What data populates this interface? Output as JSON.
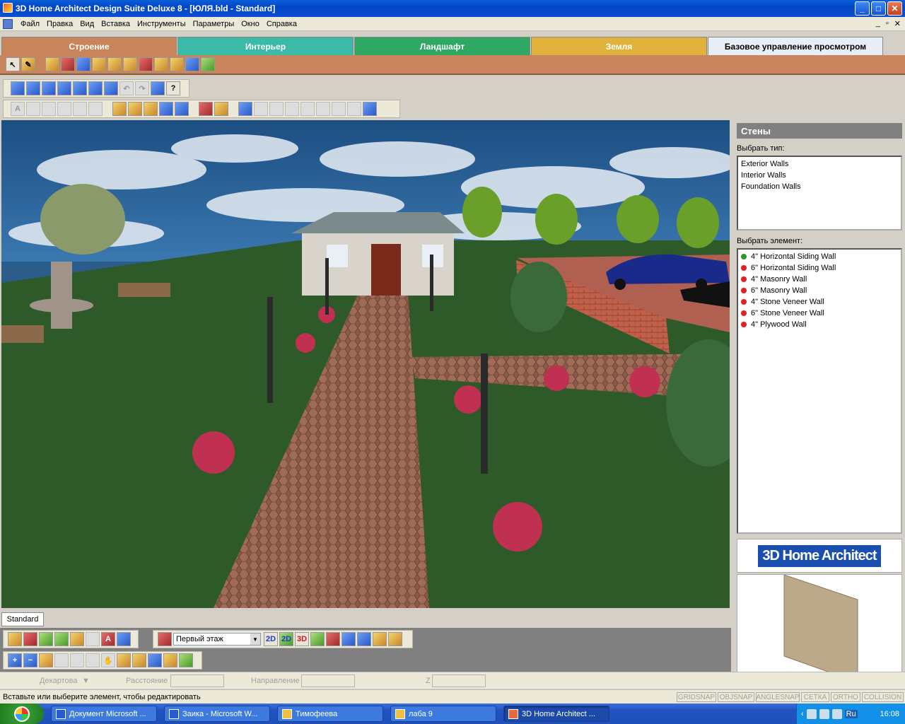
{
  "window": {
    "title": "3D Home Architect Design Suite Deluxe 8 - [ЮЛЯ.bld - Standard]"
  },
  "menu": [
    "Файл",
    "Правка",
    "Вид",
    "Вставка",
    "Инструменты",
    "Параметры",
    "Окно",
    "Справка"
  ],
  "tabs": [
    {
      "label": "Строение",
      "color": "#c8845a"
    },
    {
      "label": "Интерьер",
      "color": "#3cbaa8"
    },
    {
      "label": "Ландшафт",
      "color": "#2fa864"
    },
    {
      "label": "Земля",
      "color": "#e0b23c"
    },
    {
      "label": "Базовое управление просмотром",
      "color": "#e8eef5"
    }
  ],
  "viewport": {
    "tab_label": "Standard"
  },
  "panel": {
    "title": "Стены",
    "type_label": "Выбрать тип:",
    "types": [
      "Exterior Walls",
      "Interior Walls",
      "Foundation Walls"
    ],
    "element_label": "Выбрать элемент:",
    "elements": [
      {
        "label": "4\" Horizontal Siding Wall",
        "status": "green"
      },
      {
        "label": "6\" Horizontal Siding Wall",
        "status": "red"
      },
      {
        "label": "4\" Masonry Wall",
        "status": "red"
      },
      {
        "label": "6\" Masonry Wall",
        "status": "red"
      },
      {
        "label": "4\" Stone Veneer Wall",
        "status": "red"
      },
      {
        "label": "6\" Stone Veneer Wall",
        "status": "red"
      },
      {
        "label": "4\" Plywood Wall",
        "status": "red"
      }
    ],
    "logo": "3D Home Architect"
  },
  "floor_select": {
    "value": "Первый этаж"
  },
  "view_buttons": {
    "plan2d": "2D",
    "plan2d_alt": "2D",
    "view3d": "3D"
  },
  "coords": {
    "mode": "Декартова",
    "distance": "Расстояние",
    "direction": "Направление",
    "z": "Z"
  },
  "status": {
    "text": "Вставьте или выберите элемент, чтобы редактировать",
    "snaps": [
      "GRIDSNAP",
      "OBJSNAP",
      "ANGLESNAP",
      "СЕТКА",
      "ORTHO",
      "COLLISION"
    ]
  },
  "taskbar": {
    "items": [
      {
        "label": "Документ Microsoft ..."
      },
      {
        "label": "Заика - Microsoft W..."
      },
      {
        "label": "Тимофеева"
      },
      {
        "label": "лаба 9"
      },
      {
        "label": "3D Home Architect ..."
      }
    ],
    "lang": "Ru",
    "clock": "16:08"
  },
  "colors": {
    "green_dot": "#2a9a2a",
    "red_dot": "#e02020"
  }
}
